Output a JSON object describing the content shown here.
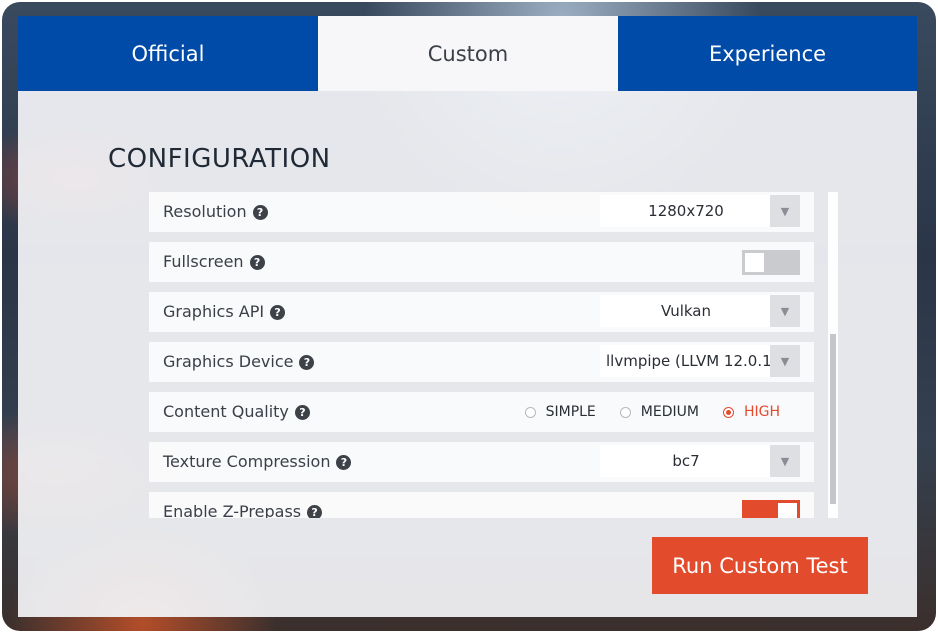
{
  "tabs": [
    {
      "label": "Official",
      "active": false
    },
    {
      "label": "Custom",
      "active": true
    },
    {
      "label": "Experience",
      "active": false
    }
  ],
  "section_title": "CONFIGURATION",
  "help_icon": "?",
  "settings": {
    "resolution": {
      "label": "Resolution",
      "value": "1280x720"
    },
    "fullscreen": {
      "label": "Fullscreen",
      "enabled": false
    },
    "graphics_api": {
      "label": "Graphics API",
      "value": "Vulkan"
    },
    "graphics_device": {
      "label": "Graphics Device",
      "value": "llvmpipe (LLVM 12.0.1,"
    },
    "content_quality": {
      "label": "Content Quality",
      "options": [
        "SIMPLE",
        "MEDIUM",
        "HIGH"
      ],
      "selected": "HIGH"
    },
    "texture_compression": {
      "label": "Texture Compression",
      "value": "bc7"
    },
    "z_prepass": {
      "label": "Enable Z-Prepass",
      "enabled": true
    }
  },
  "run_button": {
    "label": "Run Custom Test"
  },
  "colors": {
    "tab_blue": "#004aa8",
    "accent": "#e34b2d"
  }
}
